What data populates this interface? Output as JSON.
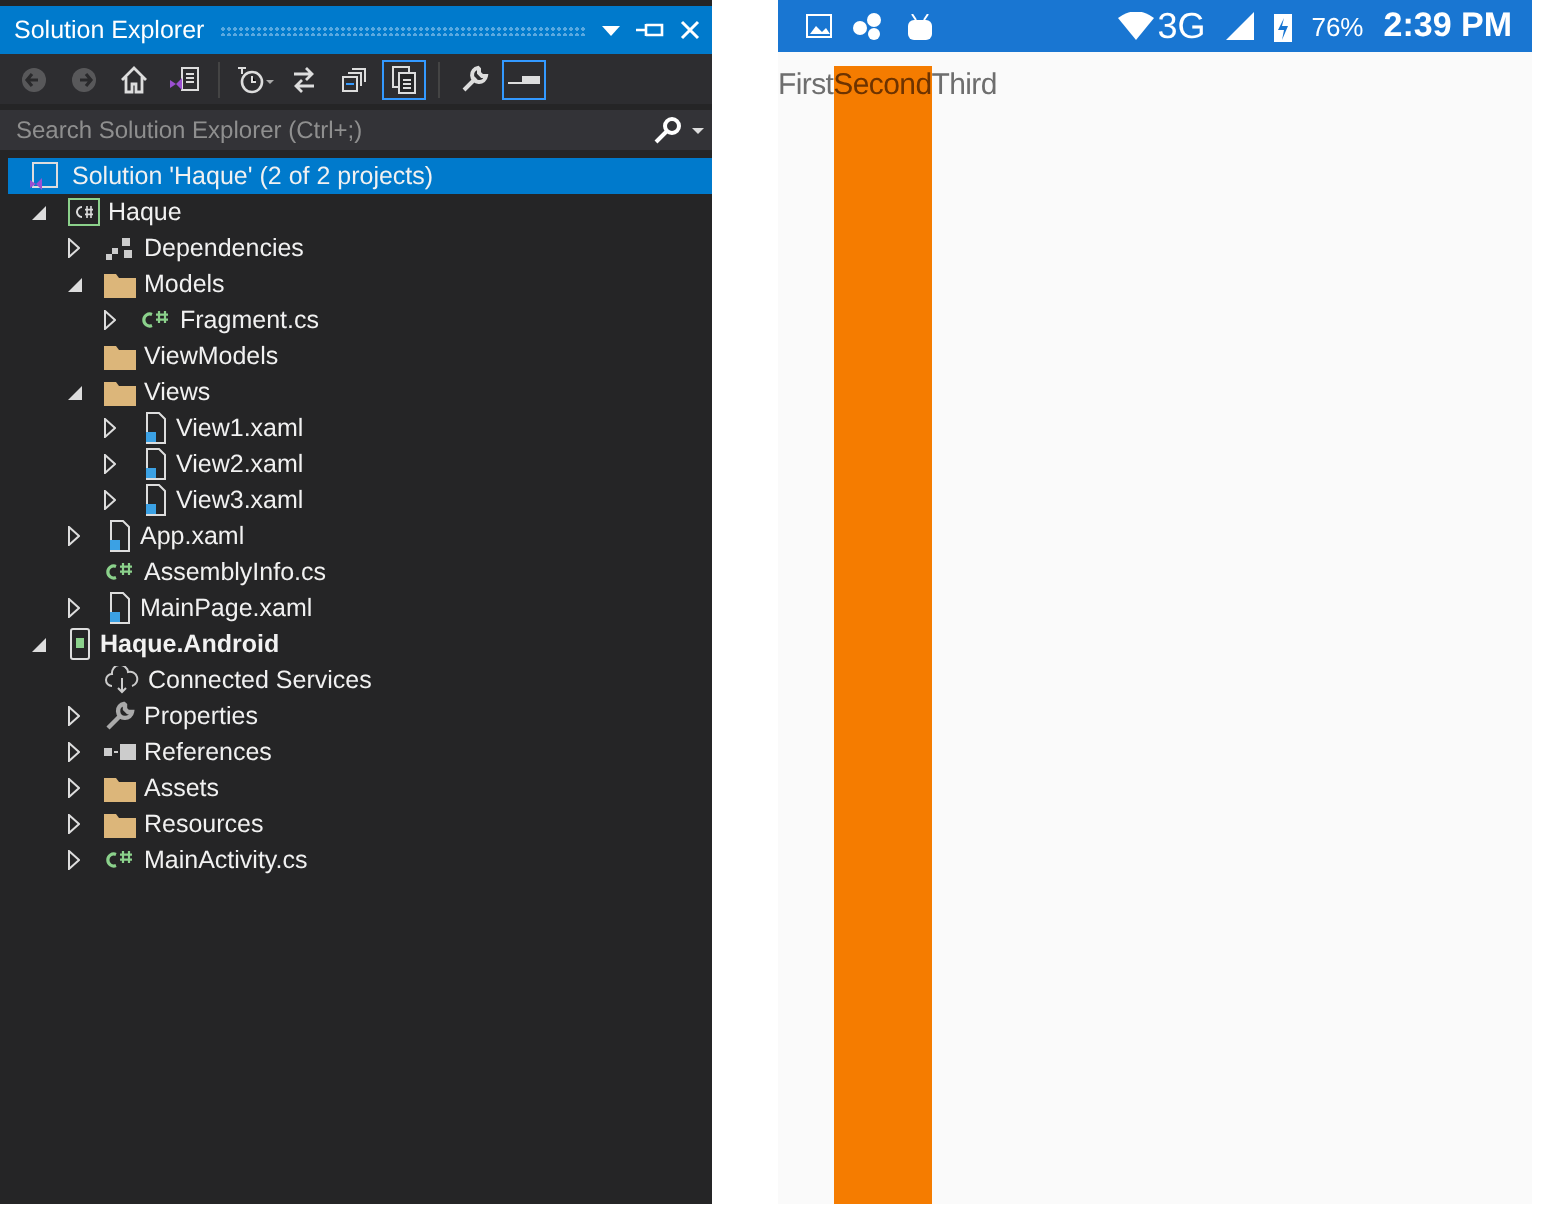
{
  "solution_explorer": {
    "title": "Solution Explorer",
    "toolbar": [
      {
        "kind": "back",
        "on": false,
        "disabled": true
      },
      {
        "kind": "forward",
        "on": false,
        "disabled": true
      },
      {
        "kind": "home",
        "on": false,
        "disabled": false
      },
      {
        "kind": "switch-views",
        "on": false,
        "disabled": false
      },
      {
        "kind": "pending-changes",
        "on": false,
        "disabled": false
      },
      {
        "kind": "sync",
        "on": false,
        "disabled": false
      },
      {
        "kind": "collapse-all",
        "on": false,
        "disabled": false
      },
      {
        "kind": "show-all-files",
        "on": true,
        "disabled": false
      },
      {
        "kind": "properties",
        "on": false,
        "disabled": false
      },
      {
        "kind": "preview",
        "on": true,
        "disabled": false
      }
    ],
    "search": {
      "placeholder": "Search Solution Explorer (Ctrl+;)"
    },
    "tree": [
      {
        "label": "Solution 'Haque' (2 of 2 projects)",
        "kind": "solution",
        "selected": true,
        "children": [
          {
            "label": "Haque",
            "kind": "cs-project",
            "selected": false,
            "startup": false,
            "expanded": true,
            "children": [
              {
                "label": "Dependencies",
                "kind": "dependencies",
                "selected": false,
                "expanded": false
              },
              {
                "label": "Models",
                "kind": "folder",
                "selected": false,
                "expanded": true,
                "children": [
                  {
                    "label": "Fragment.cs",
                    "kind": "csharp",
                    "selected": false,
                    "expanded": false
                  }
                ]
              },
              {
                "label": "ViewModels",
                "kind": "folder",
                "selected": false
              },
              {
                "label": "Views",
                "kind": "folder",
                "selected": false,
                "expanded": true,
                "children": [
                  {
                    "label": "View1.xaml",
                    "kind": "xaml",
                    "selected": false,
                    "expanded": false
                  },
                  {
                    "label": "View2.xaml",
                    "kind": "xaml",
                    "selected": false,
                    "expanded": false
                  },
                  {
                    "label": "View3.xaml",
                    "kind": "xaml",
                    "selected": false,
                    "expanded": false
                  }
                ]
              },
              {
                "label": "App.xaml",
                "kind": "xaml",
                "selected": false,
                "expanded": false
              },
              {
                "label": "AssemblyInfo.cs",
                "kind": "csharp",
                "selected": false
              },
              {
                "label": "MainPage.xaml",
                "kind": "xaml",
                "selected": false,
                "expanded": false
              }
            ]
          },
          {
            "label": "Haque.Android",
            "kind": "android-project",
            "selected": false,
            "startup": true,
            "expanded": true,
            "children": [
              {
                "label": "Connected Services",
                "kind": "cloud",
                "selected": false
              },
              {
                "label": "Properties",
                "kind": "wrench",
                "selected": false,
                "expanded": false
              },
              {
                "label": "References",
                "kind": "references",
                "selected": false,
                "expanded": false
              },
              {
                "label": "Assets",
                "kind": "folder",
                "selected": false,
                "expanded": false
              },
              {
                "label": "Resources",
                "kind": "folder",
                "selected": false,
                "expanded": false
              },
              {
                "label": "MainActivity.cs",
                "kind": "csharp",
                "selected": false,
                "expanded": false
              }
            ]
          }
        ]
      }
    ]
  },
  "phone": {
    "status_bar": {
      "network": "3G",
      "battery": "76%",
      "time": "2:39 PM"
    },
    "tabs": [
      {
        "label": "First",
        "selected": false
      },
      {
        "label": "Second",
        "selected": true
      },
      {
        "label": "Third",
        "selected": false
      }
    ]
  }
}
